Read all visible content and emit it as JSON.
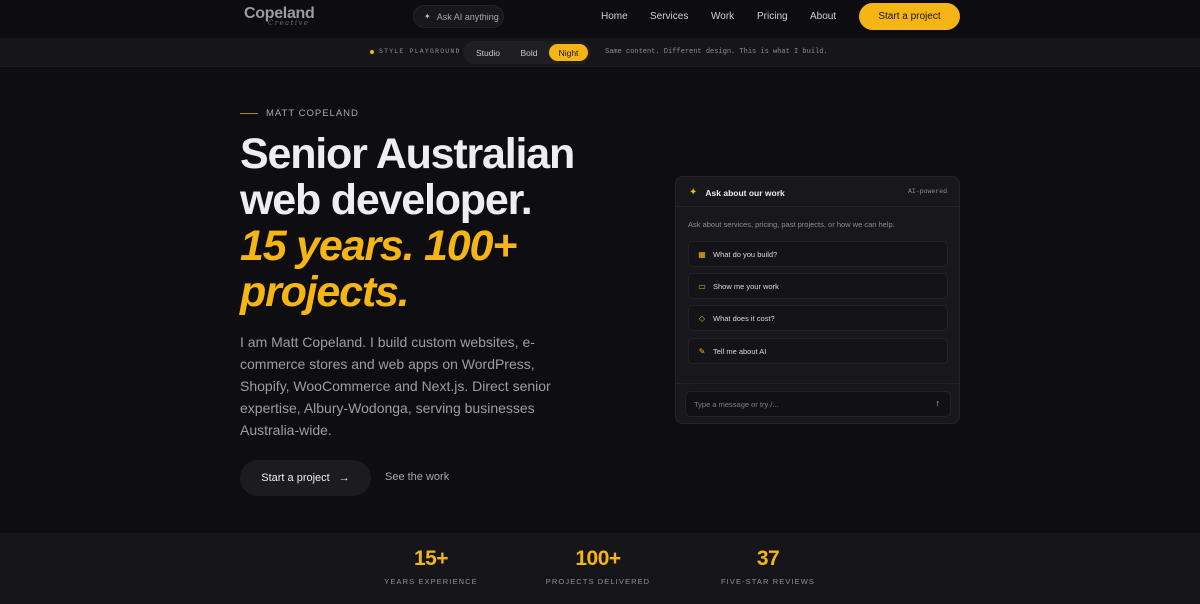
{
  "nav": {
    "logo": "Copeland",
    "logo_script": "Creative",
    "ask_label": "Ask AI anything",
    "links": [
      "Home",
      "Services",
      "Work",
      "Pricing",
      "About"
    ],
    "cta": "Start a project"
  },
  "style_bar": {
    "label": "STYLE PLAYGROUND",
    "options": [
      "Studio",
      "Bold",
      "Night"
    ],
    "selected": "Night",
    "tagline": "Same content. Different design. This is what I build."
  },
  "hero": {
    "eyebrow": "MATT COPELAND",
    "title_line1": "Senior Australian",
    "title_line2": "web developer.",
    "title_accent1": "15 years. 100+",
    "title_accent2": "projects.",
    "lead": "I am Matt Copeland. I build custom websites, e-commerce stores and web apps on WordPress, Shopify, WooCommerce and Next.js. Direct senior expertise, Albury-Wodonga, serving businesses Australia-wide.",
    "primary_button": "Start a project",
    "primary_arrow": "→",
    "secondary_link": "See the work"
  },
  "chat": {
    "title": "Ask about our work",
    "badge": "AI-powered",
    "intro": "Ask about services, pricing, past projects, or how we can help.",
    "suggestions": [
      {
        "label": "What do you build?",
        "icon": "grid-icon"
      },
      {
        "label": "Show me your work",
        "icon": "folder-icon"
      },
      {
        "label": "What does it cost?",
        "icon": "tag-icon"
      },
      {
        "label": "Tell me about AI",
        "icon": "pencil-icon"
      }
    ],
    "input_placeholder": "Type a message or try /...",
    "send_icon": "↑"
  },
  "stats": [
    {
      "value": "15+",
      "label": "YEARS EXPERIENCE"
    },
    {
      "value": "100+",
      "label": "PROJECTS DELIVERED"
    },
    {
      "value": "37",
      "label": "FIVE-STAR REVIEWS"
    }
  ],
  "colors": {
    "accent": "#f5b515",
    "background": "#0e0e12",
    "panel": "#17171c"
  }
}
